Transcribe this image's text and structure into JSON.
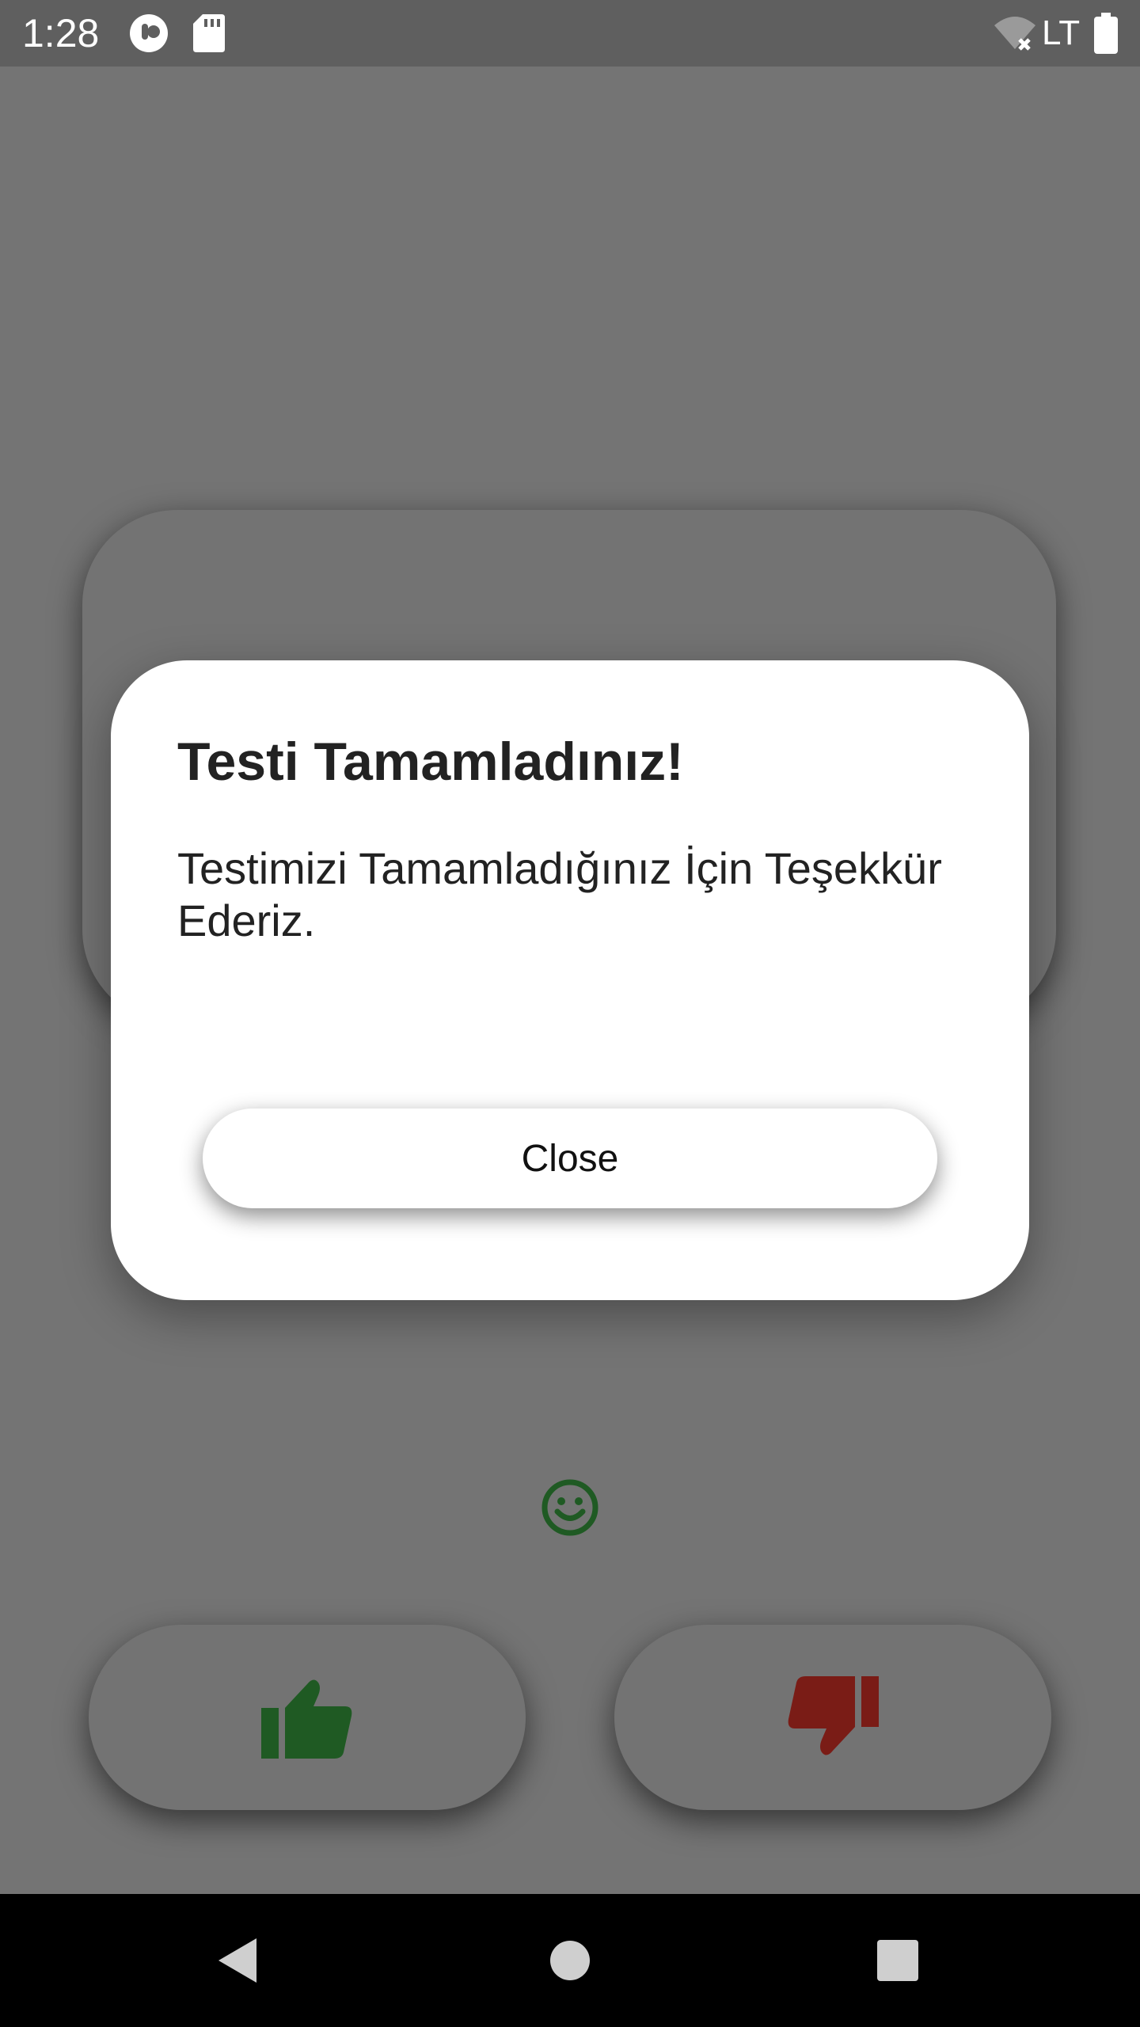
{
  "status_bar": {
    "time": "1:28",
    "network_label": "LTE",
    "icons": [
      "app-notification-icon",
      "sd-card-icon",
      "wifi-off-icon",
      "battery-icon"
    ]
  },
  "dialog": {
    "title": "Testi Tamamladınız!",
    "message": "Testimizi Tamamladığınız İçin Teşekkür Ederiz.",
    "close_label": "Close"
  },
  "background": {
    "feedback_icon": "smiley-icon",
    "like_icon": "thumbs-up-icon",
    "dislike_icon": "thumbs-down-icon"
  },
  "nav_bar": {
    "icons": [
      "back-icon",
      "home-icon",
      "recents-icon"
    ]
  },
  "colors": {
    "scrim_background": "#747474",
    "status_bar": "#5f5f5f",
    "dialog_background": "#ffffff",
    "like_green": "#1f5a23",
    "dislike_red": "#7a1c16",
    "nav_bar": "#000000"
  }
}
